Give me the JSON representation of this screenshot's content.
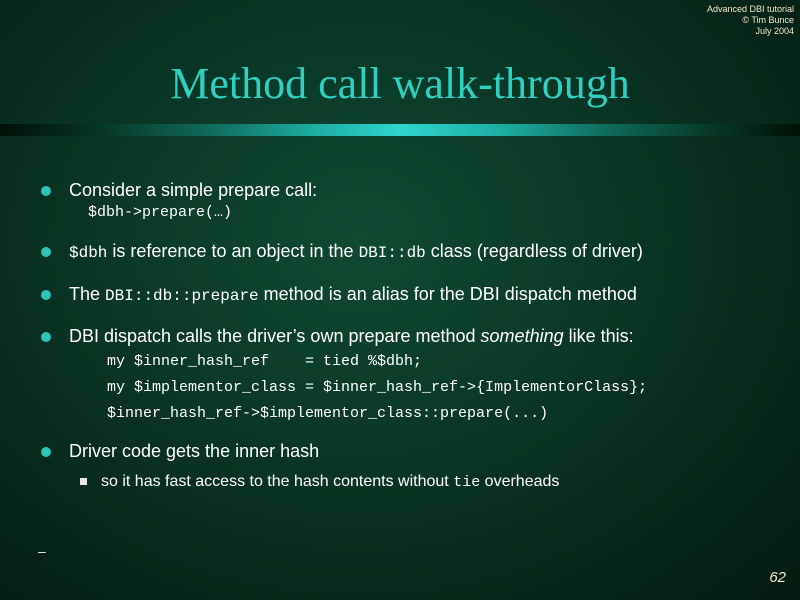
{
  "header_note": {
    "line1": "Advanced DBI tutorial",
    "line2": "© Tim Bunce",
    "line3": "July 2004"
  },
  "title": "Method call walk-through",
  "bullets": {
    "b1": {
      "text": "Consider a simple prepare call:",
      "code": "$dbh->prepare(…)"
    },
    "b2": {
      "code1": "$dbh",
      "text1": " is reference to an object in the ",
      "code2": "DBI::db",
      "text2": " class (regardless of driver)"
    },
    "b3": {
      "text1": "The ",
      "code1": "DBI::db::prepare",
      "text2": " method is an alias for the DBI dispatch method"
    },
    "b4": {
      "text1": "DBI dispatch calls the driver’s own prepare method ",
      "em": "something",
      "text2": " like this:",
      "code_lines": [
        "my $inner_hash_ref    = tied %$dbh;",
        "my $implementor_class = $inner_hash_ref->{ImplementorClass};",
        "$inner_hash_ref->$implementor_class::prepare(...)"
      ]
    },
    "b5": {
      "text": "Driver code gets the inner hash",
      "sub": {
        "text1": "so it has fast access to the hash contents without ",
        "code": "tie",
        "text2": " overheads"
      }
    }
  },
  "footer": {
    "dash": "–",
    "page_number": "62"
  },
  "colors": {
    "title": "#2fd0c0",
    "bullet": "#2fc4b8",
    "background": "#0b3a28",
    "header_note": "#f5e9c8"
  }
}
